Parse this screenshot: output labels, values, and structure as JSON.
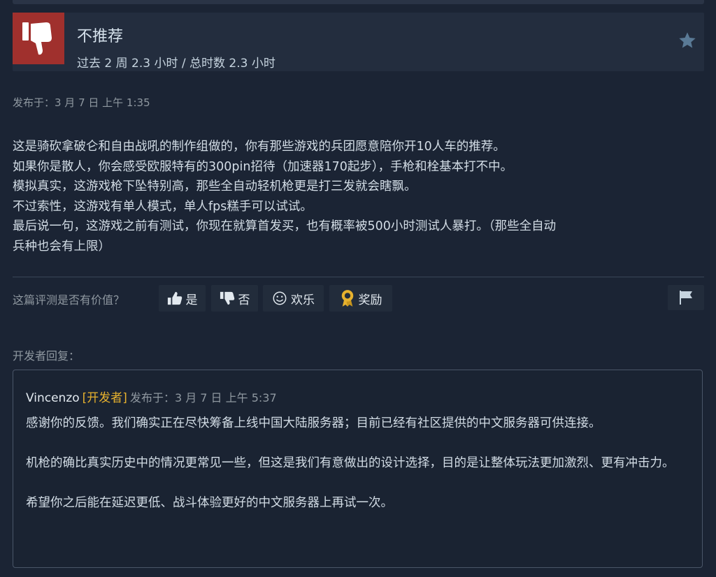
{
  "review": {
    "verdict": "不推荐",
    "hours": "过去 2 周 2.3 小时 / 总时数 2.3 小时",
    "posted": "发布于：3 月 7 日 上午 1:35",
    "body_lines": [
      "这是骑砍拿破仑和自由战吼的制作组做的，你有那些游戏的兵团愿意陪你开10人车的推荐。",
      "如果你是散人，你会感受欧服特有的300pin招待（加速器170起步），手枪和栓基本打不中。",
      "模拟真实，这游戏枪下坠特别高，那些全自动轻机枪更是打三发就会瞎飘。",
      "不过索性，这游戏有单人模式，单人fps糕手可以试试。",
      "最后说一句，这游戏之前有测试，你现在就算首发买，也有概率被500小时测试人暴打。（那些全自动",
      "兵种也会有上限）"
    ]
  },
  "helpful": {
    "question": "这篇评测是否有价值？",
    "yes": "是",
    "no": "否",
    "funny": "欢乐",
    "award": "奖励"
  },
  "developer_reply": {
    "label": "开发者回复：",
    "author": "Vincenzo",
    "tag": "[开发者]",
    "posted": "发布于：3 月 7 日 上午 5:37",
    "paragraphs": [
      "感谢你的反馈。我们确实正在尽快筹备上线中国大陆服务器；目前已经有社区提供的中文服务器可供连接。",
      "机枪的确比真实历史中的情况更常见一些，但这是我们有意做出的设计选择，目的是让整体玩法更加激烈、更有冲击力。",
      "希望你之后能在延迟更低、战斗体验更好的中文服务器上再试一次。"
    ]
  },
  "icons": {
    "verdict": "thumbs-down-icon",
    "favorite": "star-icon",
    "yes": "thumbs-up-icon",
    "no": "thumbs-down-icon",
    "funny": "smiley-icon",
    "award": "award-ribbon-icon",
    "report": "flag-icon"
  },
  "colors": {
    "background": "#1b2434",
    "not_recommended": "#a0302d",
    "developer_tag": "#e6b12e"
  }
}
